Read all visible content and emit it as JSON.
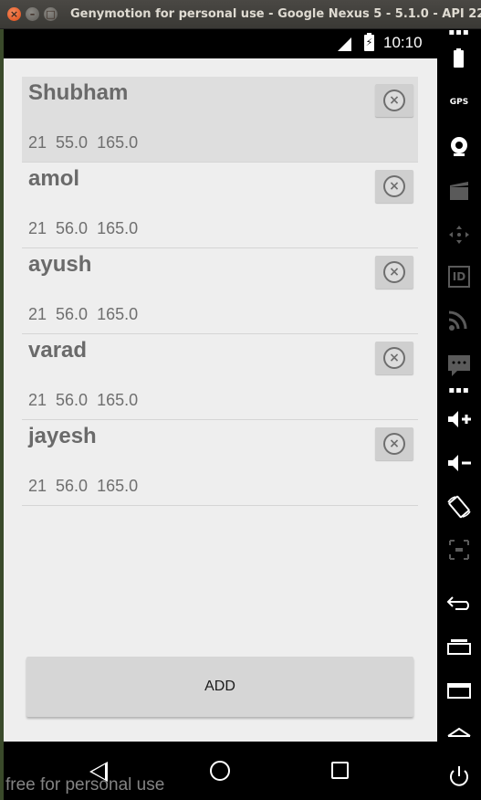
{
  "window": {
    "title": "Genymotion for personal use - Google Nexus 5 - 5.1.0 - API 22 -",
    "close_glyph": "×",
    "min_glyph": "–",
    "max_glyph": "□"
  },
  "status_bar": {
    "time": "10:10",
    "battery_glyph": "⚡"
  },
  "people": [
    {
      "name": "Shubham",
      "age": "21",
      "weight": "55.0",
      "height": "165.0",
      "selected": true
    },
    {
      "name": "amol",
      "age": "21",
      "weight": "56.0",
      "height": "165.0",
      "selected": false
    },
    {
      "name": "ayush",
      "age": "21",
      "weight": "56.0",
      "height": "165.0",
      "selected": false
    },
    {
      "name": "varad",
      "age": "21",
      "weight": "56.0",
      "height": "165.0",
      "selected": false
    },
    {
      "name": "jayesh",
      "age": "21",
      "weight": "56.0",
      "height": "165.0",
      "selected": false
    }
  ],
  "delete_glyph": "×",
  "add_button": {
    "label": "ADD"
  },
  "watermark": "free for personal use",
  "toolbar": {
    "gps_label": "GPS",
    "id_label": "ID",
    "dots": "▪▪▪",
    "icons": [
      "battery-icon",
      "gps-icon",
      "camera-icon",
      "video-capture-icon",
      "dpad-icon",
      "device-id-icon",
      "rss-icon",
      "sms-icon",
      "volume-up-icon",
      "volume-down-icon",
      "rotate-icon",
      "pixel-perfect-icon",
      "back-icon",
      "recent-apps-icon",
      "menu-icon",
      "home-icon",
      "power-icon"
    ]
  },
  "colors": {
    "app_background": "#eeeeee",
    "selected_row": "#dedede",
    "button": "#d6d6d6",
    "text_primary": "#6a6a6a"
  }
}
